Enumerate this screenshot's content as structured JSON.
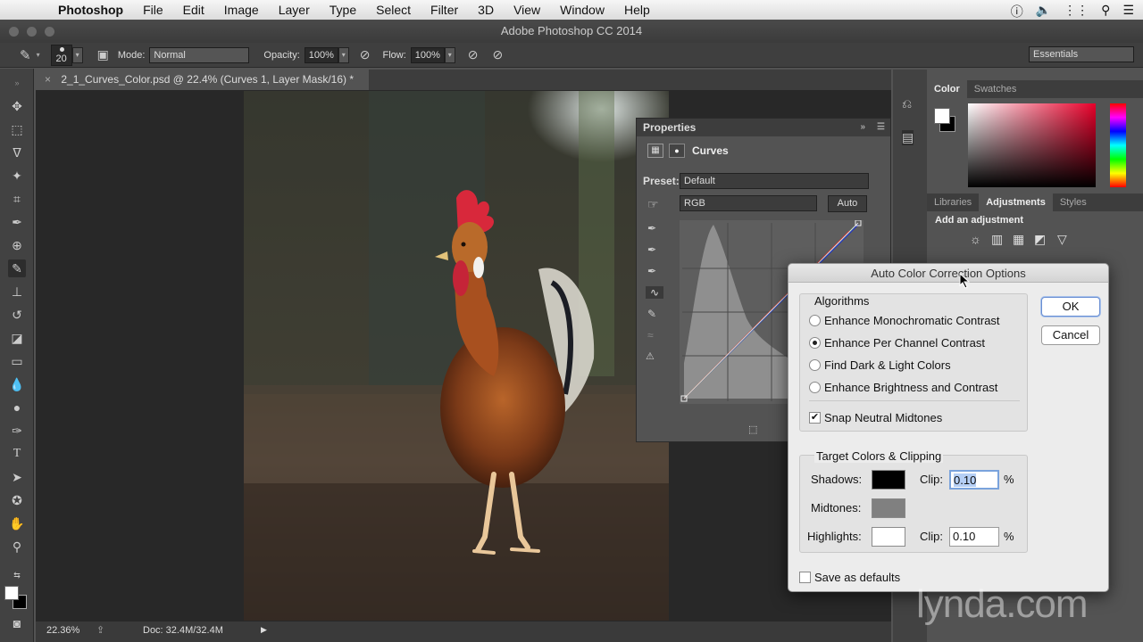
{
  "menubar": {
    "app": "Photoshop",
    "items": [
      "File",
      "Edit",
      "Image",
      "Layer",
      "Type",
      "Select",
      "Filter",
      "3D",
      "View",
      "Window",
      "Help"
    ]
  },
  "window_title": "Adobe Photoshop CC 2014",
  "options": {
    "size": "20",
    "mode_label": "Mode:",
    "mode_value": "Normal",
    "opacity_label": "Opacity:",
    "opacity_value": "100%",
    "flow_label": "Flow:",
    "flow_value": "100%",
    "workspace": "Essentials"
  },
  "doc_tab": "2_1_Curves_Color.psd @ 22.4% (Curves 1, Layer Mask/16) *",
  "status": {
    "zoom": "22.36%",
    "doc": "Doc: 32.4M/32.4M"
  },
  "properties": {
    "title": "Properties",
    "type_label": "Curves",
    "preset_label": "Preset:",
    "preset_value": "Default",
    "channel": "RGB",
    "auto": "Auto"
  },
  "right_panel": {
    "tabs1": [
      "Color",
      "Swatches"
    ],
    "tabs2": [
      "Libraries",
      "Adjustments",
      "Styles"
    ],
    "add_adjustment": "Add an adjustment"
  },
  "dialog": {
    "title": "Auto Color Correction Options",
    "algorithms_label": "Algorithms",
    "algorithms": [
      {
        "label": "Enhance Monochromatic Contrast",
        "selected": false
      },
      {
        "label": "Enhance Per Channel Contrast",
        "selected": true
      },
      {
        "label": "Find Dark & Light Colors",
        "selected": false
      },
      {
        "label": "Enhance Brightness and Contrast",
        "selected": false
      }
    ],
    "snap_label": "Snap Neutral Midtones",
    "snap_checked": true,
    "target_label": "Target Colors & Clipping",
    "shadows_label": "Shadows:",
    "midtones_label": "Midtones:",
    "highlights_label": "Highlights:",
    "clip_label": "Clip:",
    "shadows_clip": "0.10",
    "highlights_clip": "0.10",
    "percent": "%",
    "save_defaults": "Save as defaults",
    "ok": "OK",
    "cancel": "Cancel",
    "shadow_color": "#000000",
    "midtone_color": "#808080",
    "highlight_color": "#ffffff"
  },
  "watermark": "lynda.com"
}
